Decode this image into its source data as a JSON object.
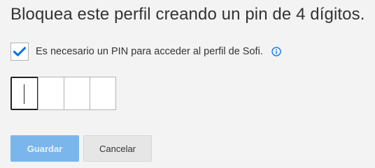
{
  "title": "Bloquea este perfil creando un pin de 4 dígitos.",
  "require_pin": {
    "checked": true,
    "label": "Es necesario un PIN para acceder al perfil de Sofi.",
    "info_icon": "info-circle-icon"
  },
  "pin": {
    "digits": [
      "",
      "",
      "",
      ""
    ],
    "active_index": 0
  },
  "buttons": {
    "save_label": "Guardar",
    "cancel_label": "Cancelar"
  },
  "colors": {
    "accent": "#0071eb",
    "save_button_bg": "#7ab6ec",
    "background": "#f3f3f3"
  }
}
